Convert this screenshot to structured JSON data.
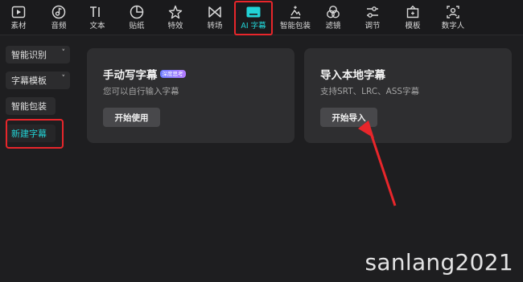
{
  "toolbar": {
    "items": [
      {
        "label": "素材",
        "icon": "media-icon"
      },
      {
        "label": "音频",
        "icon": "music-note-icon"
      },
      {
        "label": "文本",
        "icon": "text-icon"
      },
      {
        "label": "贴纸",
        "icon": "sticker-icon"
      },
      {
        "label": "特效",
        "icon": "sparkle-star-icon"
      },
      {
        "label": "转场",
        "icon": "transition-icon"
      },
      {
        "label": "AI 字幕",
        "icon": "caption-icon"
      },
      {
        "label": "智能包装",
        "icon": "magic-sparkle-icon"
      },
      {
        "label": "滤镜",
        "icon": "filter-icon"
      },
      {
        "label": "调节",
        "icon": "adjust-sliders-icon"
      },
      {
        "label": "模板",
        "icon": "template-icon"
      },
      {
        "label": "数字人",
        "icon": "digital-human-icon"
      }
    ],
    "active_index": 6,
    "accent_color": "#22d3d6"
  },
  "sidebar": {
    "items": [
      {
        "label": "智能识别",
        "has_dropdown": true
      },
      {
        "label": "字幕模板",
        "has_dropdown": true
      },
      {
        "label": "智能包装",
        "has_dropdown": false
      },
      {
        "label": "新建字幕",
        "has_dropdown": false
      }
    ],
    "active_index": 3
  },
  "cards": {
    "manual": {
      "title": "手动写字幕",
      "badge": "深度思考",
      "subtitle": "您可以自行输入字幕",
      "button": "开始使用"
    },
    "import": {
      "title": "导入本地字幕",
      "subtitle": "支持SRT、LRC、ASS字幕",
      "button": "开始导入"
    }
  },
  "annotation_color": "#e8262b",
  "watermark": "sanlang2021"
}
